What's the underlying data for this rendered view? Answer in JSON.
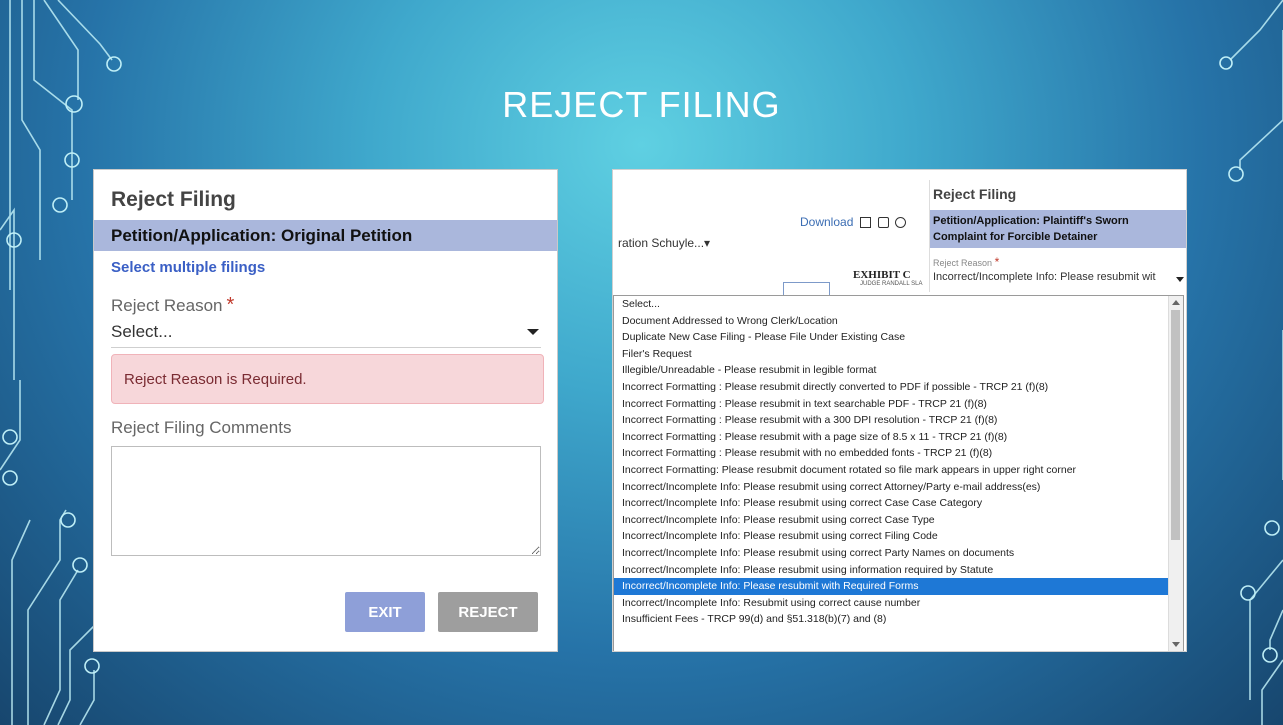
{
  "slide": {
    "title": "REJECT FILING"
  },
  "left_dialog": {
    "title": "Reject Filing",
    "filing": "Petition/Application: Original Petition",
    "select_multiple_link": "Select multiple filings",
    "reject_reason_label": "Reject Reason",
    "required_marker": "*",
    "reject_reason_value": "Select...",
    "error_message": "Reject Reason is Required.",
    "comments_label": "Reject Filing Comments",
    "comments_value": "",
    "exit_label": "EXIT",
    "reject_label": "REJECT",
    "colors": {
      "header_bar": "#aab7dc",
      "link": "#3a5fc5",
      "error_bg": "#f7d7da",
      "exit_bg": "#8e9fd8",
      "reject_bg": "#9e9e9e"
    }
  },
  "right_screen": {
    "toolbar": {
      "download_label": "Download",
      "document_select": "ration Schuyle...▾",
      "exhibit_text": "EXHIBIT C",
      "judge_text": "JUDGE RANDALL SLA"
    },
    "panel": {
      "title": "Reject Filing",
      "filing": "Petition/Application: Plaintiff's Sworn Complaint for Forcible Detainer",
      "reject_reason_label": "Reject Reason",
      "required_marker": "*",
      "reject_reason_value": "Incorrect/Incomplete Info: Please resubmit wit"
    },
    "dropdown": {
      "selected_index": 18,
      "options": [
        "Select...",
        "Document Addressed to Wrong Clerk/Location",
        "Duplicate New Case Filing - Please File Under Existing Case",
        "Filer's Request",
        "Illegible/Unreadable - Please resubmit in legible format",
        "Incorrect Formatting : Please resubmit directly converted to PDF if possible - TRCP 21 (f)(8)",
        "Incorrect Formatting : Please resubmit in text searchable PDF - TRCP 21 (f)(8)",
        "Incorrect Formatting : Please resubmit with a 300 DPI resolution - TRCP 21 (f)(8)",
        "Incorrect Formatting : Please resubmit with a page size of 8.5 x 11 - TRCP 21 (f)(8)",
        "Incorrect Formatting : Please resubmit with no embedded fonts - TRCP 21 (f)(8)",
        "Incorrect Formatting: Please resubmit document rotated so file mark appears in upper right corner",
        "Incorrect/Incomplete Info: Please resubmit using correct Attorney/Party e-mail address(es)",
        "Incorrect/Incomplete Info: Please resubmit using correct Case Case Category",
        "Incorrect/Incomplete Info: Please resubmit using correct Case Type",
        "Incorrect/Incomplete Info: Please resubmit using correct Filing Code",
        "Incorrect/Incomplete Info: Please resubmit using correct Party Names on documents",
        "Incorrect/Incomplete Info: Please resubmit using information required by Statute",
        "Incorrect/Incomplete Info: Please resubmit with Required Forms",
        "Incorrect/Incomplete Info: Please resubmit with Required Forms",
        "Incorrect/Incomplete Info: Resubmit using correct cause number",
        "Insufficient Fees - TRCP 99(d) and §51.318(b)(7) and (8)"
      ],
      "selected_color": "#1e78d6"
    }
  }
}
